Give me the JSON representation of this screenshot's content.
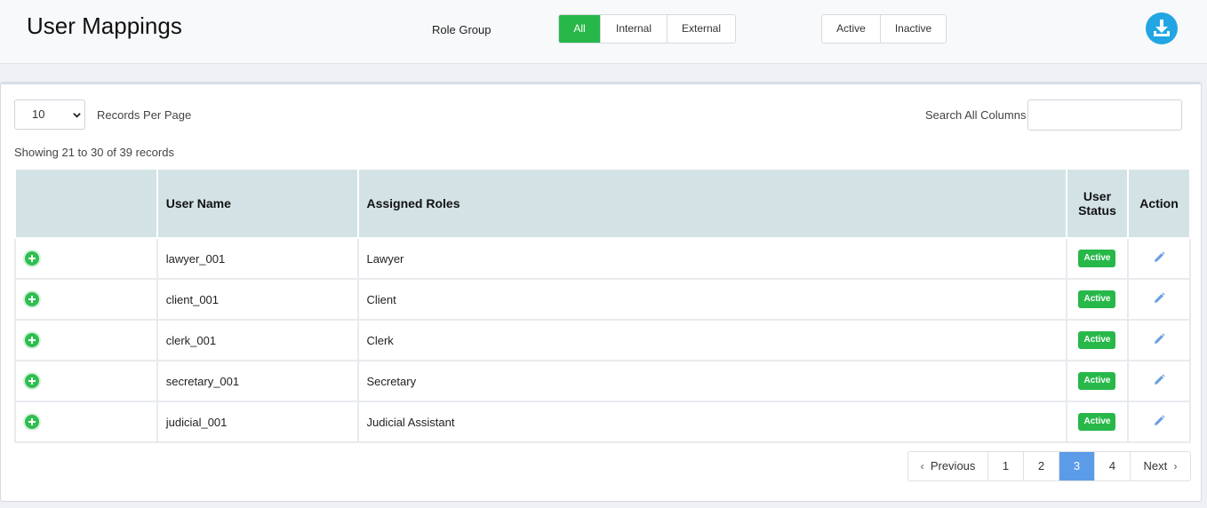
{
  "header": {
    "title": "User Mappings",
    "role_group_label": "Role Group",
    "role_filters": [
      "All",
      "Internal",
      "External"
    ],
    "role_filter_selected": "All",
    "status_filters": [
      "Active",
      "Inactive"
    ],
    "download_icon": "download-icon"
  },
  "controls": {
    "per_page_value": "10",
    "per_page_label": "Records Per Page",
    "search_label": "Search All Columns",
    "search_value": "",
    "showing_text": "Showing 21 to 30 of 39 records"
  },
  "table": {
    "columns": {
      "expand": "",
      "user_name": "User Name",
      "assigned_roles": "Assigned Roles",
      "user_status_line1": "User",
      "user_status_line2": "Status",
      "action": "Action"
    },
    "rows": [
      {
        "user_name": "lawyer_001",
        "roles": "Lawyer",
        "status": "Active"
      },
      {
        "user_name": "client_001",
        "roles": "Client",
        "status": "Active"
      },
      {
        "user_name": "clerk_001",
        "roles": "Clerk",
        "status": "Active"
      },
      {
        "user_name": "secretary_001",
        "roles": "Secretary",
        "status": "Active"
      },
      {
        "user_name": "judicial_001",
        "roles": "Judicial Assistant",
        "status": "Active"
      }
    ]
  },
  "pagination": {
    "previous": "Previous",
    "next": "Next",
    "pages": [
      "1",
      "2",
      "3",
      "4"
    ],
    "current": "3"
  },
  "colors": {
    "accent_green": "#28b84a",
    "download_blue": "#22a6e3",
    "page_current": "#5b9be8",
    "table_header": "#d3e2e5"
  }
}
